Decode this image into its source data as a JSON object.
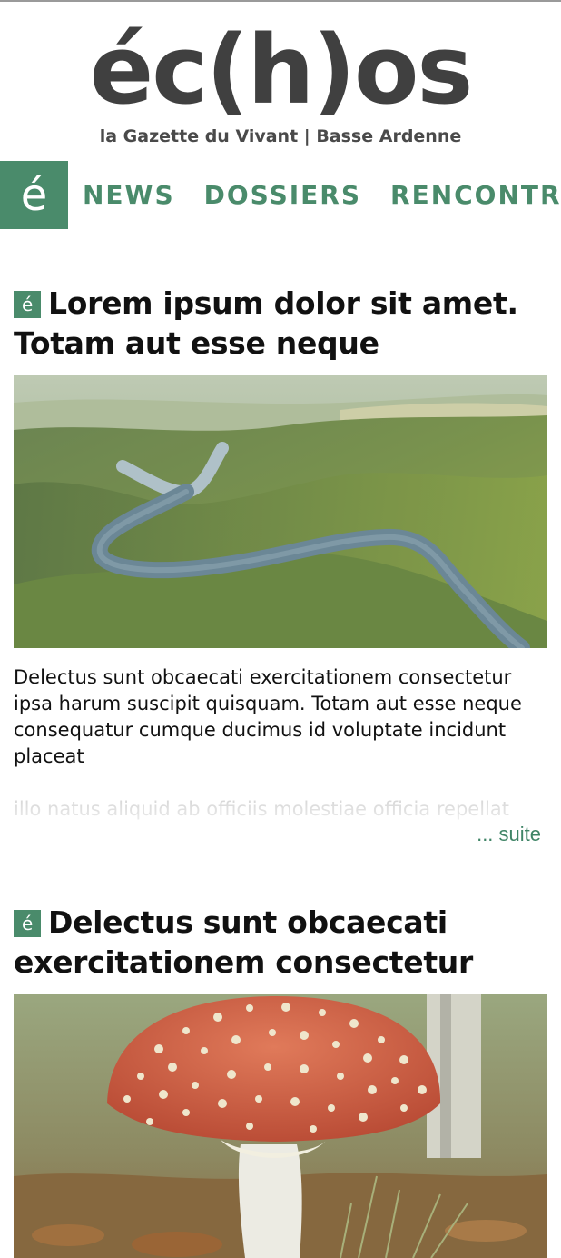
{
  "masthead": {
    "logo": "éc(h)os",
    "tagline": "la Gazette du Vivant | Basse Ardenne"
  },
  "nav": {
    "logo_glyph": "é",
    "items": [
      "NEWS",
      "DOSSIERS",
      "RENCONTRES"
    ]
  },
  "colors": {
    "brand_green": "#4a8b6b",
    "text": "#111111",
    "logo_gray": "#404040"
  },
  "articles": [
    {
      "badge": "é",
      "title": "Lorem ipsum dolor sit amet. Totam aut esse neque",
      "paragraph1": "Delectus sunt obcaecati exercitationem consectetur ipsa harum suscipit quisquam. Totam aut esse neque consequatur cumque ducimus id voluptate incidunt placeat",
      "paragraph2": "illo natus aliquid ab officiis molestiae officia repellat eligendi saepe odio quia culpa similique",
      "more_label": "... suite",
      "image": "aerial river meander through forested hills"
    },
    {
      "badge": "é",
      "title": "Delectus sunt obcaecati exercitationem consectetur",
      "image": "red fly agaric mushroom in autumn leaves"
    }
  ]
}
